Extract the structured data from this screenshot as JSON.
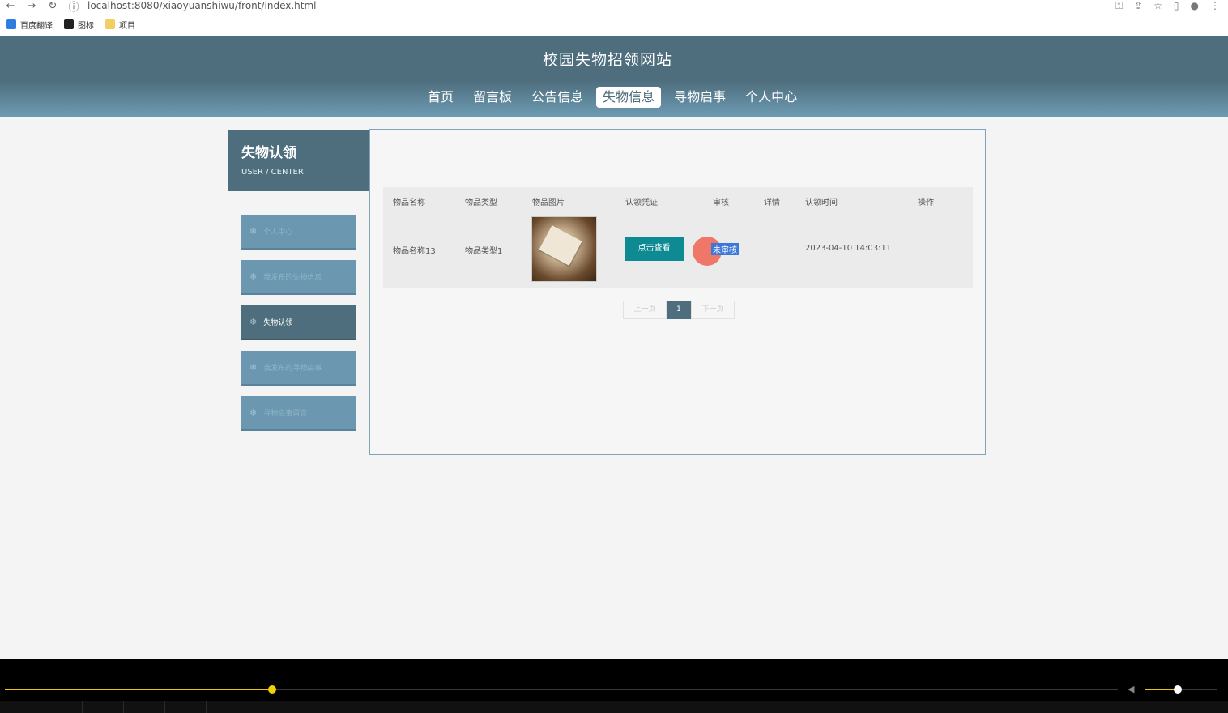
{
  "browser": {
    "url": "localhost:8080/xiaoyuanshiwu/front/index.html",
    "bookmarks": [
      "百度翻译",
      "图标",
      "项目"
    ]
  },
  "header": {
    "title": "校园失物招领网站",
    "menu": [
      "首页",
      "留言板",
      "公告信息",
      "失物信息",
      "寻物启事",
      "个人中心"
    ],
    "active": "失物信息"
  },
  "sidebar": {
    "title": "失物认领",
    "subtitle": "USER / CENTER",
    "items": [
      "个人中心",
      "我发布的失物信息",
      "失物认领",
      "我发布的寻物启事",
      "寻物启事留言"
    ],
    "active": "失物认领"
  },
  "table": {
    "columns": [
      "物品名称",
      "物品类型",
      "物品图片",
      "认领凭证",
      "审核",
      "详情",
      "认领时间",
      "操作"
    ],
    "rows": [
      {
        "name": "物品名称13",
        "type": "物品类型1",
        "voucher_button": "点击查看",
        "status": "未审核",
        "time": "2023-04-10 14:03:11"
      }
    ]
  },
  "pagination": {
    "prev": "上一页",
    "current": "1",
    "next": "下一页"
  },
  "player": {
    "progress": 0.24,
    "volume": 0.45
  },
  "colors": {
    "primary": "#4e6e7d",
    "side": "#6b98b0",
    "button": "#0e8a93"
  }
}
